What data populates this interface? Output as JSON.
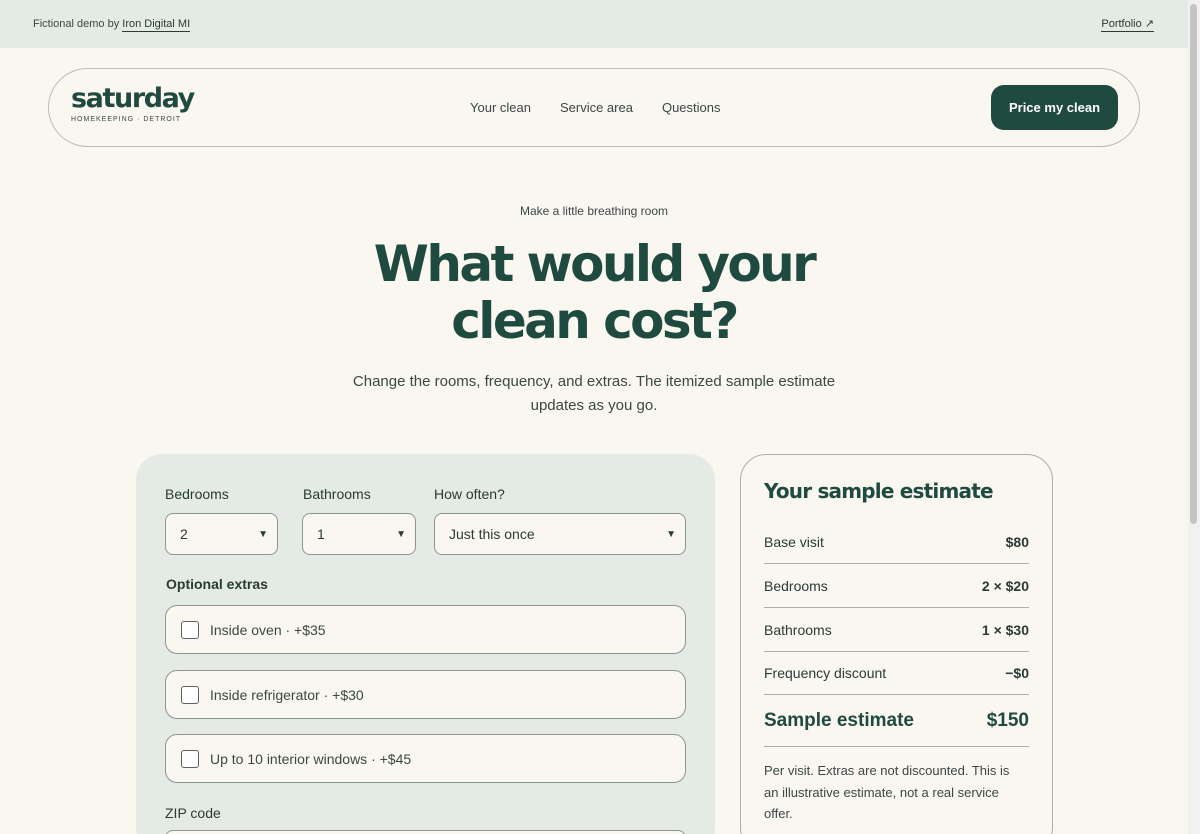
{
  "topbar": {
    "credit_prefix": "Fictional demo by",
    "credit_link": "Iron Digital MI",
    "portfolio_link": "Portfolio ↗"
  },
  "brand": {
    "name": "saturday",
    "tagline": "HOMEKEEPING · DETROIT",
    "color": "#1f4a40"
  },
  "nav": {
    "links": [
      "Your clean",
      "Service area",
      "Questions"
    ],
    "cta": "Price my clean"
  },
  "hero": {
    "eyebrow": "Make a little breathing room",
    "title": "What would your clean cost?",
    "subtitle": "Change the rooms, frequency, and extras. The itemized sample estimate updates as you go."
  },
  "form": {
    "bedrooms": {
      "label": "Bedrooms",
      "value": "2"
    },
    "bathrooms": {
      "label": "Bathrooms",
      "value": "1"
    },
    "frequency": {
      "label": "How often?",
      "value": "Just this once"
    },
    "extras_label": "Optional extras",
    "extras": [
      {
        "label": "Inside oven · +$35",
        "checked": false
      },
      {
        "label": "Inside refrigerator · +$30",
        "checked": false
      },
      {
        "label": "Up to 10 interior windows · +$45",
        "checked": false
      }
    ],
    "zip_label": "ZIP code"
  },
  "estimate": {
    "title": "Your sample estimate",
    "rows": [
      {
        "label": "Base visit",
        "value": "$80"
      },
      {
        "label": "Bedrooms",
        "value": "2 × $20"
      },
      {
        "label": "Bathrooms",
        "value": "1 × $30"
      },
      {
        "label": "Frequency discount",
        "value": "−$0"
      }
    ],
    "total_label": "Sample estimate",
    "total_value": "$150",
    "note": "Per visit. Extras are not discounted. This is an illustrative estimate, not a real service offer."
  }
}
